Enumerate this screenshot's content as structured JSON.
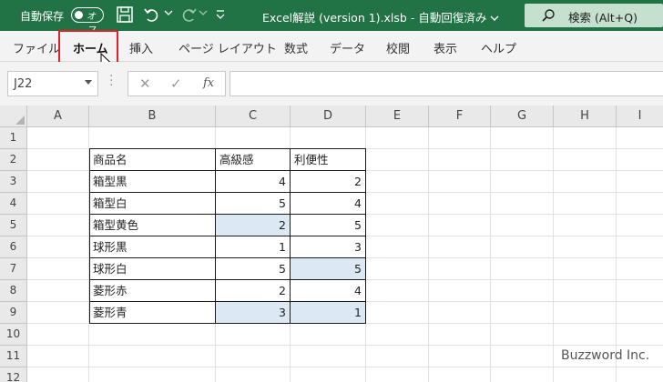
{
  "titlebar": {
    "autosave_label": "自動保存",
    "autosave_state": "オフ",
    "filename": "Excel解説 (version 1).xlsb",
    "save_state": "自動回復済み",
    "search_label": "検索 (Alt+Q)",
    "bg_color": "#217346"
  },
  "ribbon": {
    "tabs": [
      {
        "label": "ファイル"
      },
      {
        "label": "ホーム",
        "active": true
      },
      {
        "label": "挿入"
      },
      {
        "label": "ページ レイアウト"
      },
      {
        "label": "数式"
      },
      {
        "label": "データ"
      },
      {
        "label": "校閲"
      },
      {
        "label": "表示"
      },
      {
        "label": "ヘルプ"
      }
    ],
    "highlight_color": "#e0202a"
  },
  "formula_bar": {
    "name_box": "J22",
    "fx_label": "fx",
    "formula": ""
  },
  "sheet": {
    "columns": [
      "A",
      "B",
      "C",
      "D",
      "E",
      "F",
      "G",
      "H",
      "I"
    ],
    "rows": [
      "1",
      "2",
      "3",
      "4",
      "5",
      "6",
      "7",
      "8",
      "9",
      "10",
      "11",
      "12"
    ],
    "table": {
      "headers": [
        "商品名",
        "高級感",
        "利便性"
      ],
      "rows": [
        {
          "name": "箱型黒",
          "c": "4",
          "d": "2"
        },
        {
          "name": "箱型白",
          "c": "5",
          "d": "4"
        },
        {
          "name": "箱型黄色",
          "c": "2",
          "d": "5"
        },
        {
          "name": "球形黒",
          "c": "1",
          "d": "3"
        },
        {
          "name": "球形白",
          "c": "5",
          "d": "5"
        },
        {
          "name": "菱形赤",
          "c": "2",
          "d": "4"
        },
        {
          "name": "菱形青",
          "c": "3",
          "d": "1"
        }
      ]
    },
    "selection_color": "#dde8f5"
  },
  "watermark": "Buzzword Inc."
}
